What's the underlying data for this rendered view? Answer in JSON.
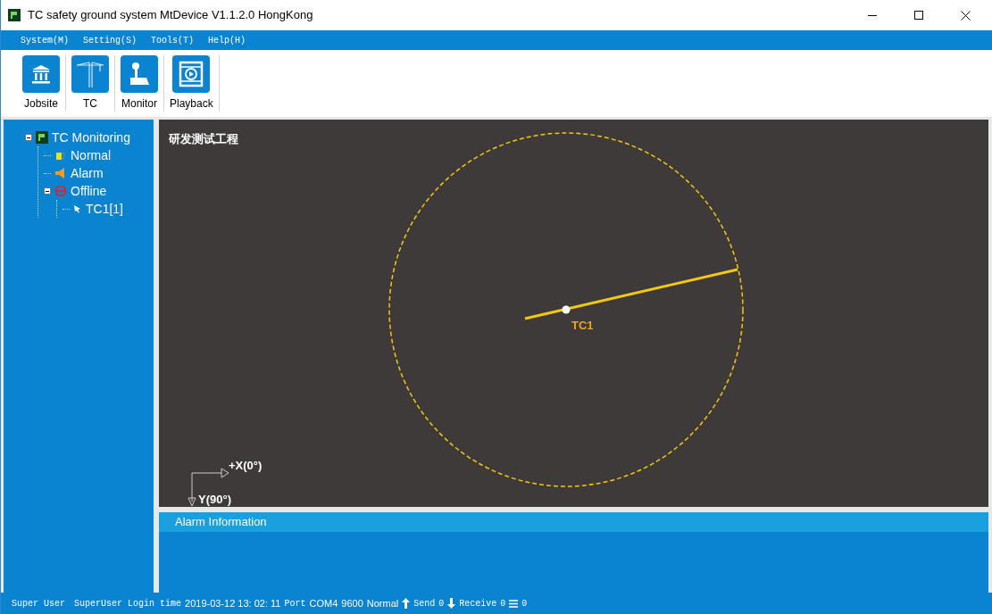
{
  "window": {
    "title": "TC safety ground system MtDevice V1.1.2.0 HongKong"
  },
  "menu": [
    "System(M)",
    "Setting(S)",
    "Tools(T)",
    "Help(H)"
  ],
  "toolbar": [
    {
      "label": "Jobsite",
      "kind": "jobsite"
    },
    {
      "label": "TC",
      "kind": "crane"
    },
    {
      "label": "Monitor",
      "kind": "joystick"
    },
    {
      "label": "Playback",
      "kind": "film"
    }
  ],
  "tree": [
    {
      "label": "TC Monitoring",
      "kind": "root",
      "expanded": true,
      "children": [
        {
          "label": "Normal",
          "kind": "normal"
        },
        {
          "label": "Alarm",
          "kind": "alarm"
        },
        {
          "label": "Offline",
          "kind": "offline",
          "expanded": true,
          "children": [
            {
              "label": "TC1[1]",
              "kind": "device"
            }
          ]
        }
      ]
    }
  ],
  "canvas": {
    "title": "研发测试工程",
    "crane_label": "TC1",
    "x_axis": "+X(0°)",
    "y_axis": "Y(90°)"
  },
  "alarm_panel": {
    "title": "Alarm Information"
  },
  "status_bar": {
    "user": "Super User",
    "login": "SuperUser Login time",
    "time": "2019-03-12 13: 02: 11",
    "port_label": "Port",
    "port": "COM4",
    "baud": "9600",
    "state": "Normal",
    "send_label": "Send",
    "send": "0",
    "receive_label": "Receive",
    "receive": "0",
    "queue": "0"
  }
}
